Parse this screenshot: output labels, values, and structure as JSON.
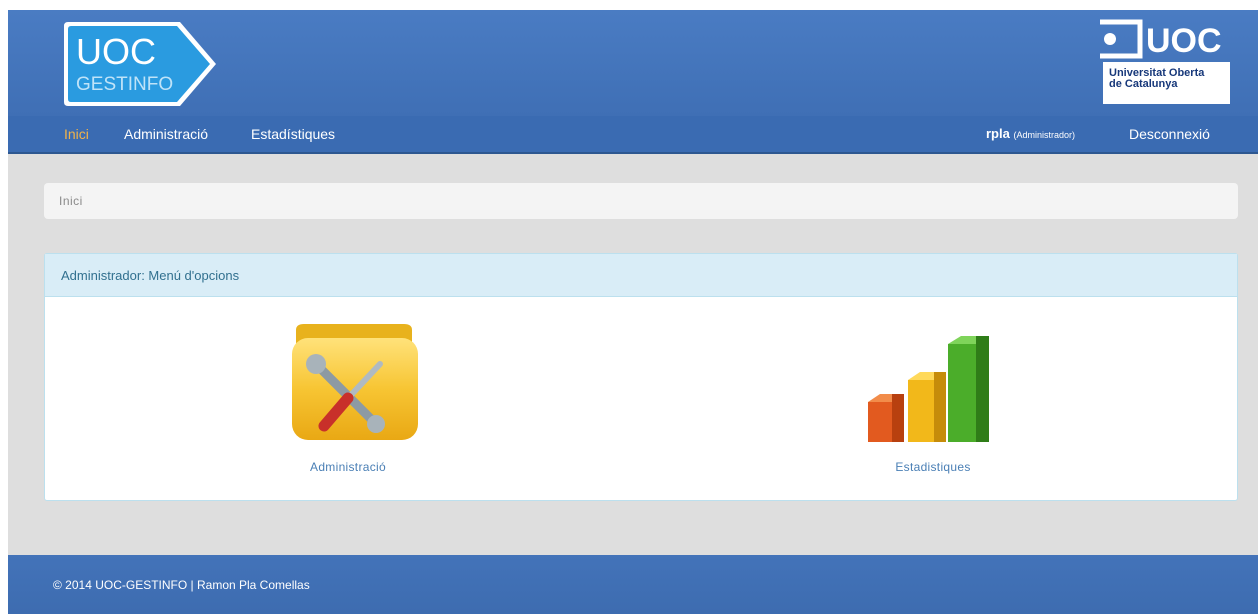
{
  "header": {
    "logo_gestinfo": {
      "line1": "UOC",
      "line2": "GESTINFO"
    },
    "logo_uoc": {
      "wordmark": "UOC",
      "line1": "Universitat Oberta",
      "line2": "de Catalunya"
    }
  },
  "nav": {
    "items": [
      {
        "label": "Inici",
        "active": true
      },
      {
        "label": "Administració",
        "active": false
      },
      {
        "label": "Estadístiques",
        "active": false
      }
    ],
    "user": {
      "name": "rpla",
      "role": "(Administrador)"
    },
    "logout_label": "Desconnexió"
  },
  "breadcrumb": {
    "current": "Inici"
  },
  "panel": {
    "title": "Administrador: Menú d'opcions",
    "options": [
      {
        "label": "Administració",
        "icon": "tools-folder-icon"
      },
      {
        "label": "Estadistiques",
        "icon": "bar-chart-icon"
      }
    ]
  },
  "footer": {
    "text": "© 2014 UOC-GESTINFO | Ramon Pla Comellas"
  },
  "colors": {
    "header_blue": "#4a7cc3",
    "nav_blue": "#3a6bb2",
    "active_nav": "#f0b34a",
    "panel_heading": "#d9edf7",
    "link_blue": "#4a7fb5"
  }
}
